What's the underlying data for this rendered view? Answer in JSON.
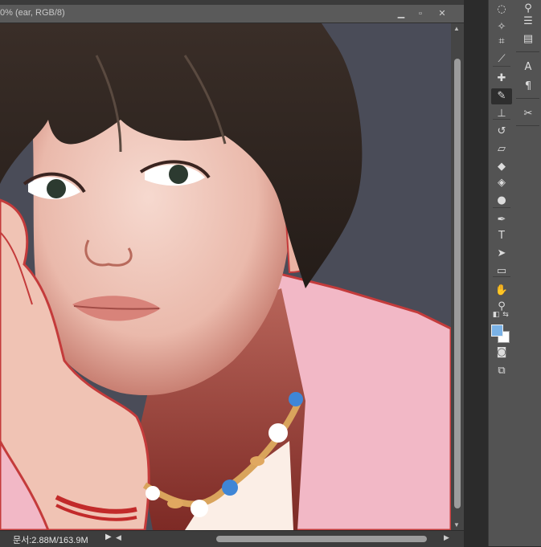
{
  "document": {
    "title": "0% (ear, RGB/8)",
    "status_doc_size": "문서:2.88M/163.9M",
    "window_buttons": {
      "minimize": "▁",
      "maximize": "▫",
      "close": "✕"
    }
  },
  "tools": [
    {
      "name": "lasso-tool",
      "glyph": "◌"
    },
    {
      "name": "magic-wand-tool",
      "glyph": "✧"
    },
    {
      "name": "crop-tool",
      "glyph": "⌗"
    },
    {
      "name": "eyedropper-tool",
      "glyph": "⟋"
    },
    {
      "name": "healing-brush-tool",
      "glyph": "✚"
    },
    {
      "name": "brush-tool",
      "glyph": "✎"
    },
    {
      "name": "clone-stamp-tool",
      "glyph": "⊥"
    },
    {
      "name": "history-brush-tool",
      "glyph": "↺"
    },
    {
      "name": "eraser-tool",
      "glyph": "▱"
    },
    {
      "name": "paint-bucket-tool",
      "glyph": "◆"
    },
    {
      "name": "blur-tool",
      "glyph": "◈"
    },
    {
      "name": "dodge-tool",
      "glyph": "●"
    },
    {
      "name": "pen-tool",
      "glyph": "✒"
    },
    {
      "name": "type-tool",
      "glyph": "T"
    },
    {
      "name": "path-selection-tool",
      "glyph": "➤"
    },
    {
      "name": "shape-tool",
      "glyph": "▭"
    },
    {
      "name": "hand-tool",
      "glyph": "✋"
    },
    {
      "name": "zoom-tool",
      "glyph": "⚲"
    }
  ],
  "active_tool": "brush-tool",
  "colors": {
    "foreground": "#7ab2e6",
    "background": "#ffffff",
    "canvas_bg": "#4a4c58"
  },
  "dock": [
    {
      "name": "brush-presets-icon",
      "glyph": "⚲"
    },
    {
      "name": "adjustments-icon",
      "glyph": "☰"
    },
    {
      "name": "properties-icon",
      "glyph": "▤"
    },
    {
      "name": "character-icon",
      "glyph": "A"
    },
    {
      "name": "paragraph-icon",
      "glyph": "¶"
    },
    {
      "name": "tools-preset-icon",
      "glyph": "✂"
    }
  ]
}
